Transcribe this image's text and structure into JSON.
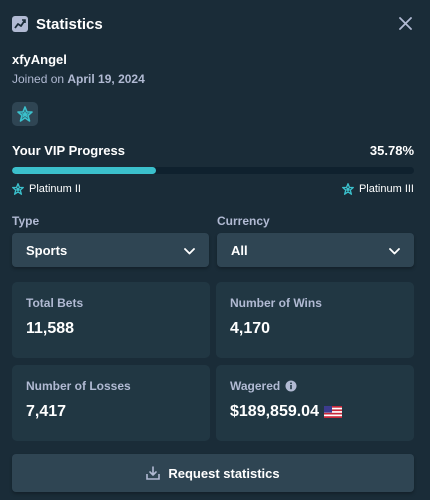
{
  "header": {
    "title": "Statistics",
    "icon": "trend-chart-icon",
    "close_icon": "close-icon"
  },
  "user": {
    "name": "xfyAngel",
    "joined_prefix": "Joined on",
    "joined_date": "April 19, 2024",
    "badge_icon": "platinum-star-icon"
  },
  "vip": {
    "label": "Your VIP Progress",
    "percent_text": "35.78%",
    "progress": 0.3578,
    "current_tier": "Platinum II",
    "next_tier": "Platinum III",
    "accent": "#3bc0cc"
  },
  "filters": {
    "type": {
      "label": "Type",
      "value": "Sports"
    },
    "currency": {
      "label": "Currency",
      "value": "All"
    }
  },
  "stats": {
    "total_bets": {
      "label": "Total Bets",
      "value": "11,588"
    },
    "wins": {
      "label": "Number of Wins",
      "value": "4,170"
    },
    "losses": {
      "label": "Number of Losses",
      "value": "7,417"
    },
    "wagered": {
      "label": "Wagered",
      "value": "$189,859.04",
      "flag_icon": "us-flag-icon",
      "info_icon": "info-icon"
    }
  },
  "actions": {
    "request_label": "Request statistics",
    "request_icon": "download-tray-icon"
  },
  "colors": {
    "background": "#1a2c38",
    "card": "#213743",
    "control": "#2f4553",
    "muted_text": "#b1bad3"
  }
}
